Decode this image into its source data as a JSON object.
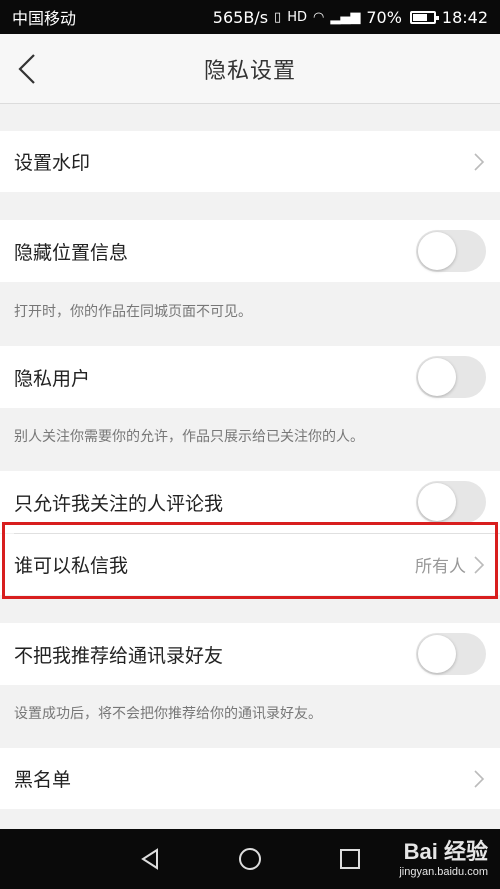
{
  "status_bar": {
    "carrier": "中国移动",
    "speed": "565B/s",
    "battery": "70%",
    "time": "18:42"
  },
  "header": {
    "title": "隐私设置"
  },
  "settings": {
    "watermark": {
      "label": "设置水印"
    },
    "hide_location": {
      "label": "隐藏位置信息",
      "desc": "打开时，你的作品在同城页面不可见。",
      "enabled": false
    },
    "private_user": {
      "label": "隐私用户",
      "desc": "别人关注你需要你的允许，作品只展示给已关注你的人。",
      "enabled": false
    },
    "comment_only_followed": {
      "label": "只允许我关注的人评论我",
      "enabled": false
    },
    "who_can_message": {
      "label": "谁可以私信我",
      "value": "所有人"
    },
    "no_recommend_contacts": {
      "label": "不把我推荐给通讯录好友",
      "desc": "设置成功后，将不会把你推荐给你的通讯录好友。",
      "enabled": false
    },
    "blacklist": {
      "label": "黑名单"
    }
  },
  "watermark_overlay": {
    "brand": "Bai 经验",
    "site": "jingyan.baidu.com"
  },
  "colors": {
    "highlight": "#d81e1e",
    "toggle_off": "#e6e6e6"
  }
}
